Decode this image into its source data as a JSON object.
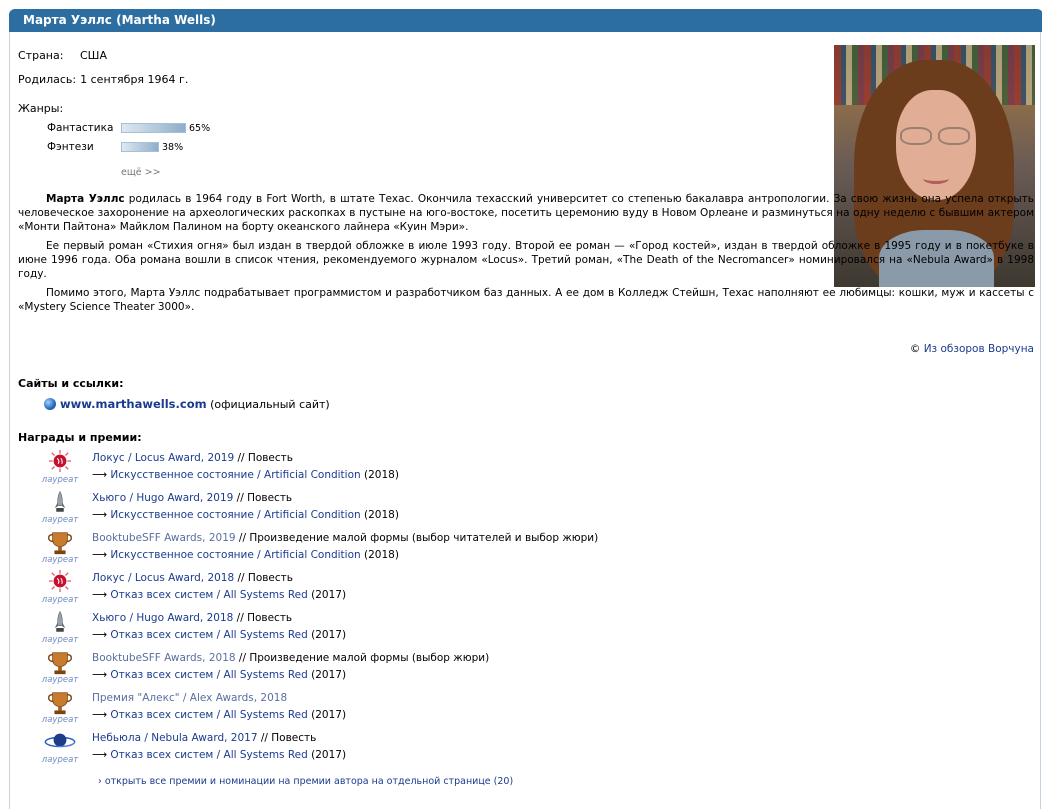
{
  "header": {
    "title": "Марта Уэллс (Martha Wells)"
  },
  "info": {
    "country_label": "Страна:",
    "country_value": "США",
    "born_label": "Родилась:",
    "born_value": "1 сентября 1964 г.",
    "genres_label": "Жанры:",
    "genres": [
      {
        "name": "Фантастика",
        "percent": 65,
        "percent_text": "65%"
      },
      {
        "name": "Фэнтези",
        "percent": 38,
        "percent_text": "38%"
      }
    ],
    "more": "ещё >>"
  },
  "bio": {
    "p1_name": "Марта Уэллс",
    "p1_rest": " родилась в 1964 году в Fort Worth, в штате Техас. Окончила техасский университет со степенью бакалавра антропологии. За свою жизнь она успела открыть человеческое захоронение на археологических раскопках в пустыне на юго-востоке, посетить церемонию вуду в Новом Орлеане и разминуться на одну неделю с бывшим актером «Монти Пайтона» Майклом Палином на борту океанского лайнера «Куин Мэри».",
    "p2": "Ее первый роман «Стихия огня» был издан в твердой обложке в июле 1993 году. Второй ее роман — «Город костей», издан в твердой обложке в 1995 году и в покетбуке в июне 1996 года. Оба романа вошли в список чтения, рекомендуемого журналом «Locus». Третий роман, «The Death of the Necromancer» номинировался на «Nebula Award» в 1998 году.",
    "p3": "Помимо этого, Марта Уэллс подрабатывает программистом и разработчиком баз данных. А ее дом в Колледж Стейшн, Техас наполняют ее любимцы: кошки, муж и кассеты с «Mystery Science Theater 3000».",
    "source_prefix": "©",
    "source_link": "Из обзоров Ворчуна"
  },
  "sites": {
    "heading": "Сайты и ссылки:",
    "url": "www.marthawells.com",
    "note": "(официальный сайт)"
  },
  "awards": {
    "heading": "Награды и премии:",
    "laureate_label": "лауреат",
    "items": [
      {
        "icon": "locus-icon",
        "award": "Локус / Locus Award, 2019",
        "category": " // Повесть",
        "work": "Искусственное состояние / Artificial Condition",
        "year": "(2018)"
      },
      {
        "icon": "hugo-rocket-icon",
        "award": "Хьюго / Hugo Award, 2019",
        "category": " // Повесть",
        "work": "Искусственное состояние / Artificial Condition",
        "year": "(2018)"
      },
      {
        "icon": "trophy-icon",
        "award": "BooktubeSFF Awards, 2019",
        "category": " // Произведение малой формы (выбор читателей и выбор жюри)",
        "work": "Искусственное состояние / Artificial Condition",
        "year": "(2018)"
      },
      {
        "icon": "locus-icon",
        "award": "Локус / Locus Award, 2018",
        "category": " // Повесть",
        "work": "Отказ всех систем / All Systems Red",
        "year": "(2017)"
      },
      {
        "icon": "hugo-rocket-icon",
        "award": "Хьюго / Hugo Award, 2018",
        "category": " // Повесть",
        "work": "Отказ всех систем / All Systems Red",
        "year": "(2017)"
      },
      {
        "icon": "trophy-icon",
        "award": "BooktubeSFF Awards, 2018",
        "category": " // Произведение малой формы (выбор жюри)",
        "work": "Отказ всех систем / All Systems Red",
        "year": "(2017)"
      },
      {
        "icon": "trophy-icon",
        "award": "Премия \"Алекс\" / Alex Awards, 2018",
        "category": "",
        "work": "Отказ всех систем / All Systems Red",
        "year": "(2017)"
      },
      {
        "icon": "nebula-planet-icon",
        "award": "Небьюла / Nebula Award, 2017",
        "category": " // Повесть",
        "work": "Отказ всех систем / All Systems Red",
        "year": "(2017)"
      }
    ],
    "arrow": "⟶",
    "all_link": "› открыть все премии и номинации на премии автора на отдельной странице (20)"
  }
}
